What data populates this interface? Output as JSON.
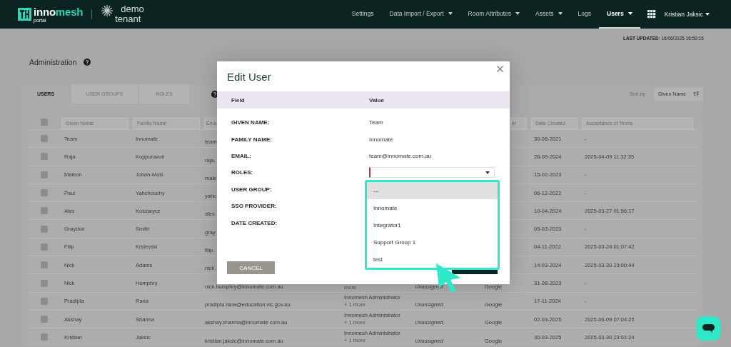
{
  "nav": {
    "logo": {
      "wordmark_a": "inno",
      "wordmark_b": "mesh",
      "tagline": "portal"
    },
    "tenant": {
      "line_1": "demo",
      "line_2": "tenant"
    },
    "items": [
      {
        "label": "Settings",
        "dropdown": false,
        "selected": false
      },
      {
        "label": "Data Import / Export",
        "dropdown": true,
        "selected": false
      },
      {
        "label": "Room Attributes",
        "dropdown": true,
        "selected": false
      },
      {
        "label": "Assets",
        "dropdown": true,
        "selected": false
      },
      {
        "label": "Logs",
        "dropdown": false,
        "selected": false
      },
      {
        "label": "Users",
        "dropdown": true,
        "selected": true
      }
    ],
    "user_menu": "Kristian Jaksic"
  },
  "last_updated": "**LAST UPDATED**: 16/06/2025 16:59:16",
  "page_title": "Administration",
  "tabs": [
    {
      "label": "USERS",
      "selected": true
    },
    {
      "label": "USER GROUPS",
      "selected": false
    },
    {
      "label": "ROLES",
      "selected": false
    }
  ],
  "sort": {
    "label": "Sort by",
    "value": "Given Name"
  },
  "table": {
    "select_all_checked": false,
    "filters": {
      "given_name": {
        "placeholder": "Given Name"
      },
      "family_name": {
        "placeholder": "Family Name"
      },
      "email": {
        "placeholder": "Ema"
      },
      "column_7": {
        "placeholder": "er"
      },
      "date_created": {
        "placeholder": "Date Created"
      },
      "acceptance_of_terms": {
        "placeholder": "Acceptance of Terms"
      }
    },
    "rows": [
      {
        "checked": false,
        "given_name": "Team",
        "family_name": "Innomate",
        "email": "team",
        "date_created": "30-08-2021",
        "acceptance_of_terms": "-"
      },
      {
        "checked": false,
        "given_name": "Raja",
        "family_name": "Koppuravuri",
        "email": "raja.",
        "date_created": "26-09-2024",
        "acceptance_of_terms": "2025-04-09 11:32:35"
      },
      {
        "checked": false,
        "given_name": "Maleon",
        "family_name": "Johan-Mosi",
        "email": "male",
        "date_created": "15-02-2023",
        "acceptance_of_terms": "-"
      },
      {
        "checked": false,
        "given_name": "Paul",
        "family_name": "Yahchouchy",
        "email": "yahc",
        "date_created": "06-12-2022",
        "acceptance_of_terms": "-"
      },
      {
        "checked": false,
        "given_name": "Alex",
        "family_name": "Koszarycz",
        "email": "alex.",
        "date_created": "10-04-2024",
        "acceptance_of_terms": "2025-03-27 01:56:17"
      },
      {
        "checked": false,
        "given_name": "Graydon",
        "family_name": "Smith",
        "email": "gray",
        "date_created": "05-03-2023",
        "acceptance_of_terms": "-"
      },
      {
        "checked": false,
        "given_name": "Filip",
        "family_name": "Krstevski",
        "email": "filip.",
        "date_created": "04-11-2022",
        "acceptance_of_terms": "2025-03-24 01:07:42"
      },
      {
        "checked": false,
        "given_name": "Nick",
        "family_name": "Adams",
        "email": "nick.",
        "date_created": "14-03-2024",
        "acceptance_of_terms": "2025-03-30 23:00:44"
      },
      {
        "checked": false,
        "given_name": "Nick",
        "family_name": "Humphry",
        "email": "nick.humphry@innomate.com.au",
        "role_more": "more",
        "user_group": "Unassigned",
        "sso_provider": "Google",
        "date_created": "31-08-2023",
        "acceptance_of_terms": "-"
      },
      {
        "checked": false,
        "given_name": "Pradipta",
        "family_name": "Rana",
        "email": "pradipta.rana@education.vic.gov.au",
        "role": "Innomesh Administrator",
        "role_more": "+ 1 more",
        "user_group": "Unassigned",
        "sso_provider": "Google",
        "date_created": "17-11-2024",
        "acceptance_of_terms": "-"
      },
      {
        "checked": false,
        "given_name": "Akshay",
        "family_name": "Sharma",
        "email": "akshay.sharma@innomate.com.au",
        "role": "Innomesh Administrator",
        "role_more": "+ 1 more",
        "user_group": "Unassigned",
        "sso_provider": "Google",
        "date_created": "02-03-2025",
        "acceptance_of_terms": "2025-06-09 07:04:25"
      },
      {
        "checked": false,
        "given_name": "Kristian",
        "family_name": "Jaksic",
        "email": "kristian.jaksic@innomate.com.au",
        "role": "Innomesh Administrator",
        "role_more": "+ 1 more",
        "user_group": "Unassigned",
        "sso_provider": "Google",
        "date_created": "30-03-2025",
        "acceptance_of_terms": "2025-03-30 23:01:24"
      }
    ]
  },
  "modal": {
    "title": "Edit User",
    "header": {
      "field": "Field",
      "value": "Value"
    },
    "fields": [
      {
        "kind": "text",
        "label": "GIVEN NAME:",
        "value": "Team"
      },
      {
        "kind": "text",
        "label": "FAMILY NAME:",
        "value": "Innomate"
      },
      {
        "kind": "text",
        "label": "EMAIL:",
        "value": "team@innomate.com.au"
      },
      {
        "kind": "select",
        "label": "ROLES:",
        "invalid": true
      },
      {
        "kind": "text",
        "label": "USER GROUP:"
      },
      {
        "kind": "text",
        "label": "SSO PROVIDER:"
      },
      {
        "kind": "text",
        "label": "DATE CREATED:"
      }
    ],
    "dropdown_options": [
      {
        "label": "---",
        "selected": true
      },
      {
        "label": "Innomate",
        "selected": false
      },
      {
        "label": "Integrator1",
        "selected": false
      },
      {
        "label": "Support Group 1",
        "selected": false
      },
      {
        "label": "test",
        "selected": false
      }
    ],
    "cancel_label": "CANCEL"
  }
}
